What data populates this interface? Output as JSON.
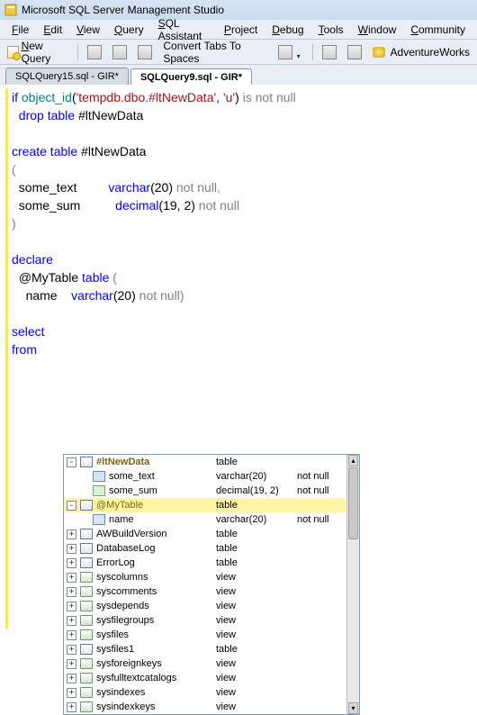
{
  "window": {
    "title": "Microsoft SQL Server Management Studio"
  },
  "menu": {
    "file": "File",
    "edit": "Edit",
    "view": "View",
    "query": "Query",
    "sql_assistant": "SQL Assistant",
    "project": "Project",
    "debug": "Debug",
    "tools": "Tools",
    "window": "Window",
    "community": "Community"
  },
  "toolbar": {
    "new_query": "New Query",
    "convert_tabs": "Convert Tabs To Spaces",
    "db_name": "AdventureWorks"
  },
  "tabs": {
    "inactive": "SQLQuery15.sql - GIR*",
    "active": "SQLQuery9.sql - GIR*"
  },
  "code": {
    "l1_if": "if",
    "l1_fn": "object_id",
    "l1_str1": "'tempdb.dbo.#ltNewData'",
    "l1_str2": "'u'",
    "l1_rest": "is not null",
    "l2_kw": "drop table",
    "l2_ident": "#ltNewData",
    "l4_kw": "create table",
    "l4_ident": "#ltNewData",
    "l5": "(",
    "l6_col": "some_text",
    "l6_type": "varchar",
    "l6_n": "20",
    "l6_rest": "not null",
    "l7_col": "some_sum",
    "l7_type": "decimal",
    "l7_n1": "19",
    "l7_n2": "2",
    "l7_rest": "not null",
    "l8": ")",
    "l10": "declare",
    "l11_var": "@MyTable",
    "l11_kw": "table",
    "l12_col": "name",
    "l12_type": "varchar",
    "l12_n": "20",
    "l12_rest": "not null",
    "l14": "select",
    "l15": "from"
  },
  "intellisense": {
    "rows": [
      {
        "toggle": "-",
        "icon": "table",
        "name": "#ltNewData",
        "type": "table",
        "nullable": "",
        "bold": true,
        "highlight": false,
        "indent": 0
      },
      {
        "toggle": "",
        "icon": "col-abc",
        "name": "some_text",
        "type": "varchar(20)",
        "nullable": "not null",
        "bold": false,
        "highlight": false,
        "indent": 1
      },
      {
        "toggle": "",
        "icon": "col-123",
        "name": "some_sum",
        "type": "decimal(19, 2)",
        "nullable": "not null",
        "bold": false,
        "highlight": false,
        "indent": 1
      },
      {
        "toggle": "-",
        "icon": "table",
        "name": "@MyTable",
        "type": "table",
        "nullable": "",
        "bold": false,
        "highlight": true,
        "indent": 0
      },
      {
        "toggle": "",
        "icon": "col-abc",
        "name": "name",
        "type": "varchar(20)",
        "nullable": "not null",
        "bold": false,
        "highlight": false,
        "indent": 1
      },
      {
        "toggle": "+",
        "icon": "table",
        "name": "AWBuildVersion",
        "type": "table",
        "nullable": "",
        "bold": false,
        "highlight": false,
        "indent": 0
      },
      {
        "toggle": "+",
        "icon": "table",
        "name": "DatabaseLog",
        "type": "table",
        "nullable": "",
        "bold": false,
        "highlight": false,
        "indent": 0
      },
      {
        "toggle": "+",
        "icon": "table",
        "name": "ErrorLog",
        "type": "table",
        "nullable": "",
        "bold": false,
        "highlight": false,
        "indent": 0
      },
      {
        "toggle": "+",
        "icon": "view",
        "name": "syscolumns",
        "type": "view",
        "nullable": "",
        "bold": false,
        "highlight": false,
        "indent": 0
      },
      {
        "toggle": "+",
        "icon": "view",
        "name": "syscomments",
        "type": "view",
        "nullable": "",
        "bold": false,
        "highlight": false,
        "indent": 0
      },
      {
        "toggle": "+",
        "icon": "view",
        "name": "sysdepends",
        "type": "view",
        "nullable": "",
        "bold": false,
        "highlight": false,
        "indent": 0
      },
      {
        "toggle": "+",
        "icon": "view",
        "name": "sysfilegroups",
        "type": "view",
        "nullable": "",
        "bold": false,
        "highlight": false,
        "indent": 0
      },
      {
        "toggle": "+",
        "icon": "view",
        "name": "sysfiles",
        "type": "view",
        "nullable": "",
        "bold": false,
        "highlight": false,
        "indent": 0
      },
      {
        "toggle": "+",
        "icon": "table",
        "name": "sysfiles1",
        "type": "table",
        "nullable": "",
        "bold": false,
        "highlight": false,
        "indent": 0
      },
      {
        "toggle": "+",
        "icon": "view",
        "name": "sysforeignkeys",
        "type": "view",
        "nullable": "",
        "bold": false,
        "highlight": false,
        "indent": 0
      },
      {
        "toggle": "+",
        "icon": "view",
        "name": "sysfulltextcatalogs",
        "type": "view",
        "nullable": "",
        "bold": false,
        "highlight": false,
        "indent": 0
      },
      {
        "toggle": "+",
        "icon": "view",
        "name": "sysindexes",
        "type": "view",
        "nullable": "",
        "bold": false,
        "highlight": false,
        "indent": 0
      },
      {
        "toggle": "+",
        "icon": "view",
        "name": "sysindexkeys",
        "type": "view",
        "nullable": "",
        "bold": false,
        "highlight": false,
        "indent": 0
      }
    ]
  }
}
